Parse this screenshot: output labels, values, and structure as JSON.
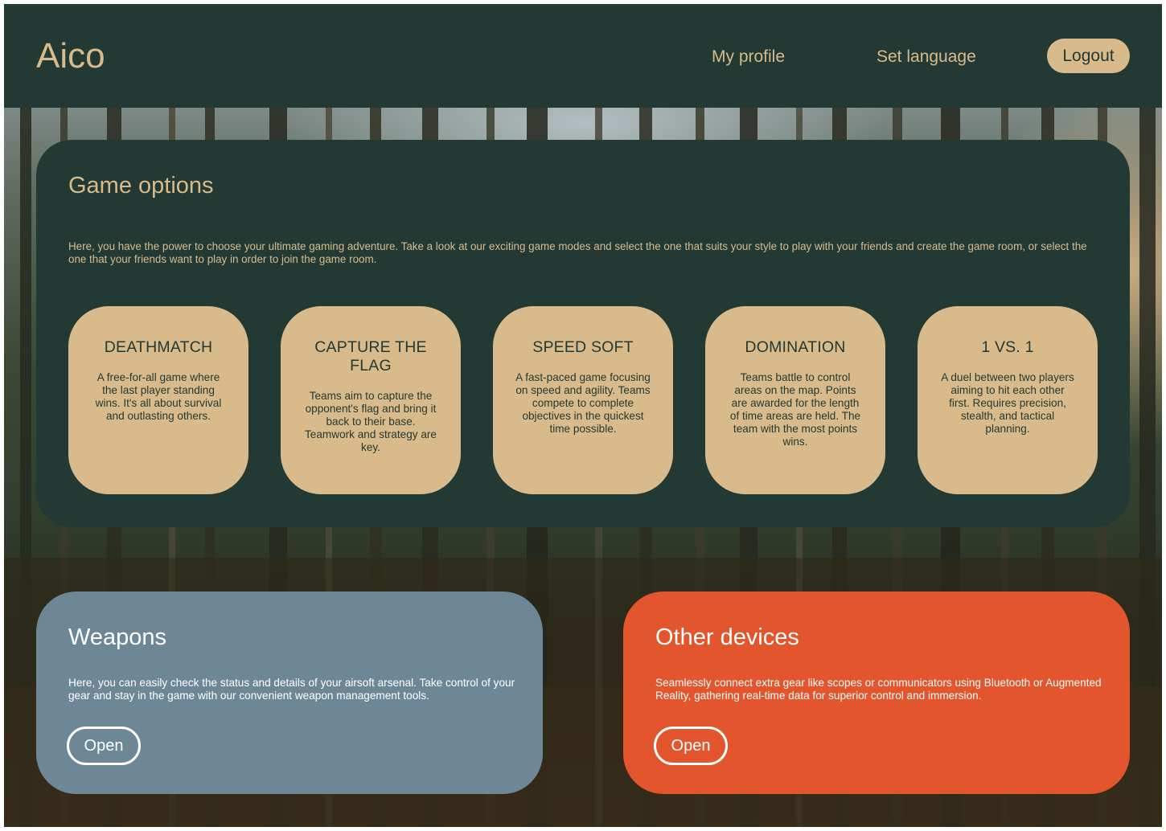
{
  "header": {
    "logo": "Aico",
    "nav": {
      "my_profile": "My profile",
      "set_language": "Set language",
      "logout": "Logout"
    }
  },
  "game_options": {
    "title": "Game options",
    "description": "Here, you have the power to choose your ultimate gaming adventure. Take a look at our exciting game modes and select the one that suits your style to play with your friends and create the game room, or select the one that your friends want to play in order to join the game room.",
    "modes": [
      {
        "title": "DEATHMATCH",
        "description": "A free-for-all game where the last player standing wins. It's all about survival and outlasting others."
      },
      {
        "title": "CAPTURE THE FLAG",
        "description": "Teams aim to capture the opponent's flag and bring it back to their base. Teamwork and strategy are key."
      },
      {
        "title": "SPEED SOFT",
        "description": "A fast-paced game focusing on speed and agility. Teams compete to complete objectives in the quickest time possible."
      },
      {
        "title": "DOMINATION",
        "description": "Teams battle to control areas on the map. Points are awarded for the length of time areas are held. The team with the most points wins."
      },
      {
        "title": "1 VS. 1",
        "description": "A duel between two players aiming to hit each other first. Requires precision, stealth, and tactical planning."
      }
    ]
  },
  "weapons": {
    "title": "Weapons",
    "description": "Here, you can easily check the status and details of your airsoft arsenal. Take control of your gear and stay in the game with our convenient weapon management tools.",
    "button": "Open"
  },
  "other_devices": {
    "title": "Other devices",
    "description": "Seamlessly connect extra gear like scopes or communicators using Bluetooth or Augmented Reality, gathering real-time data for superior control and immersion.",
    "button": "Open"
  },
  "colors": {
    "dark_green": "#233a34",
    "sand": "#d9bb8b",
    "slate_blue": "#6e8797",
    "orange": "#e3562d",
    "white": "#ffffff"
  }
}
